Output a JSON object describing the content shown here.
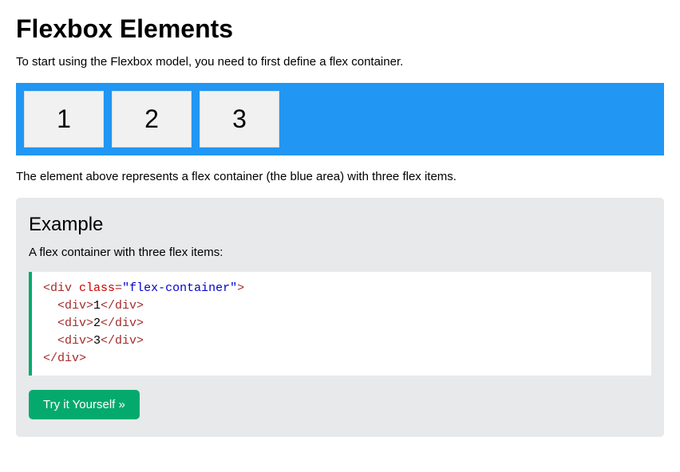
{
  "heading": "Flexbox Elements",
  "intro": "To start using the Flexbox model, you need to first define a flex container.",
  "flex_items": [
    "1",
    "2",
    "3"
  ],
  "desc": "The element above represents a flex container (the blue area) with three flex items.",
  "example": {
    "title": "Example",
    "subtitle": "A flex container with three flex items:",
    "button": "Try it Yourself »"
  },
  "code": {
    "open_tag": "div",
    "attr_name": "class",
    "attr_value": "\"flex-container\"",
    "children": [
      {
        "tag": "div",
        "text": "1"
      },
      {
        "tag": "div",
        "text": "2"
      },
      {
        "tag": "div",
        "text": "3"
      }
    ],
    "close_tag": "div"
  }
}
